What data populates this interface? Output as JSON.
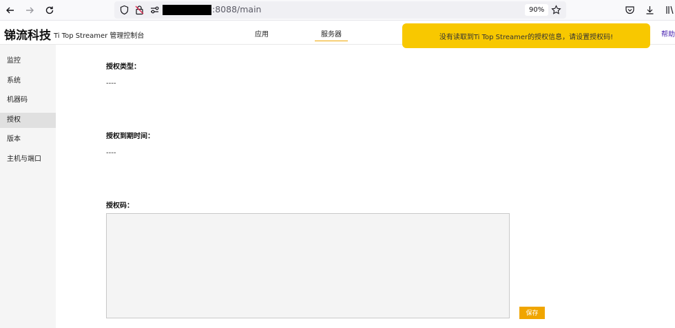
{
  "browser": {
    "url_suffix": ":8088/main",
    "zoom": "90%",
    "colors": {
      "chrome_bg": "#f9f9fb",
      "url_bg": "#f0f0f4"
    }
  },
  "header": {
    "brand": "锑流科技",
    "subtitle": "Ti Top Streamer 管理控制台",
    "tabs": [
      {
        "label": "应用",
        "active": false
      },
      {
        "label": "服务器",
        "active": true
      }
    ],
    "help": "帮助"
  },
  "alert": {
    "message": "没有读取到Ti Top Streamer的授权信息，请设置授权码!",
    "color": "#f8c800"
  },
  "sidebar": {
    "items": [
      {
        "label": "监控",
        "active": false
      },
      {
        "label": "系统",
        "active": false
      },
      {
        "label": "机器码",
        "active": false
      },
      {
        "label": "授权",
        "active": true
      },
      {
        "label": "版本",
        "active": false
      },
      {
        "label": "主机与端口",
        "active": false
      }
    ]
  },
  "main": {
    "license_type_label": "授权类型：",
    "license_type_value": "----",
    "expiry_label": "授权到期时间：",
    "expiry_value": "----",
    "code_label": "授权码：",
    "code_value": "",
    "save_label": "保存",
    "accent_color": "#f0a500"
  }
}
